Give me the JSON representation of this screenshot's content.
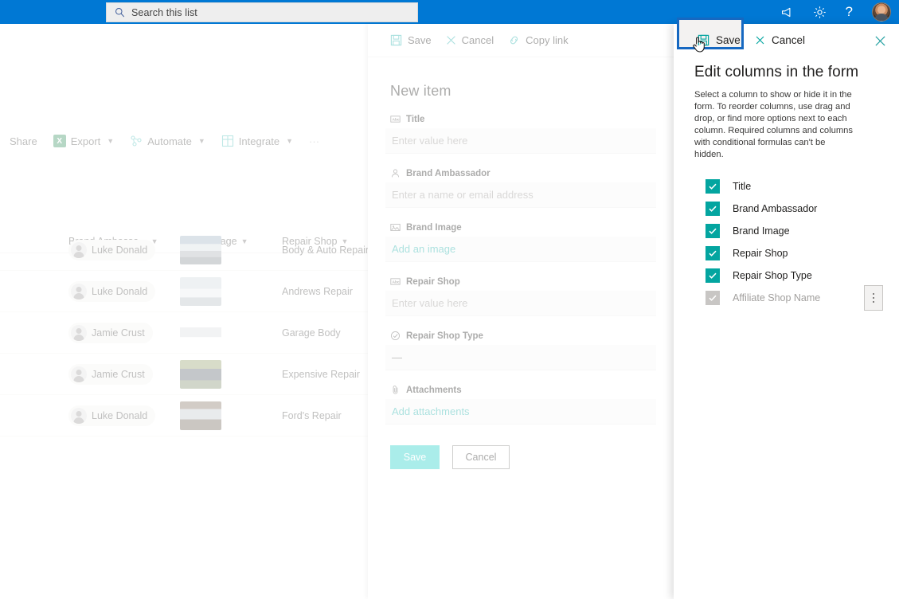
{
  "suite": {
    "search_placeholder": "Search this list",
    "search_value": "",
    "icons": [
      {
        "name": "megaphone-icon",
        "label": "What's new"
      },
      {
        "name": "gear-icon",
        "label": "Settings"
      },
      {
        "name": "help-icon",
        "label": "Help"
      }
    ],
    "avatar_label": "Account manager",
    "brand_color": "#0078d4"
  },
  "list": {
    "commands": [
      {
        "label": "Share",
        "icon": "share-icon",
        "chevron": false
      },
      {
        "label": "Export",
        "icon": "excel-icon",
        "chevron": true
      },
      {
        "label": "Automate",
        "icon": "automate-icon",
        "chevron": true
      },
      {
        "label": "Integrate",
        "icon": "integrate-icon",
        "chevron": true
      },
      {
        "label": "···",
        "icon": "more-icon",
        "chevron": false
      }
    ],
    "columns": [
      {
        "label": "Brand Ambassa...",
        "chevron": true
      },
      {
        "label": "Brand Image",
        "chevron": true
      },
      {
        "label": "Repair Shop",
        "chevron": true
      }
    ],
    "rows": [
      {
        "ambassador": "Luke Donald",
        "image": "car-thumbnail",
        "shop": "Body & Auto Repair"
      },
      {
        "ambassador": "Luke Donald",
        "image": "car-thumbnail",
        "shop": "Andrews Repair"
      },
      {
        "ambassador": "Jamie Crust",
        "image": "car-thumbnail",
        "shop": "Garage Body"
      },
      {
        "ambassador": "Jamie Crust",
        "image": "car-thumbnail",
        "shop": "Expensive Repair"
      },
      {
        "ambassador": "Luke Donald",
        "image": "car-thumbnail",
        "shop": "Ford's Repair"
      }
    ]
  },
  "form": {
    "commands": [
      {
        "label": "Save",
        "icon": "save-icon"
      },
      {
        "label": "Cancel",
        "icon": "close-icon"
      },
      {
        "label": "Copy link",
        "icon": "link-icon"
      }
    ],
    "title": "New item",
    "fields": [
      {
        "label": "Title",
        "icon": "text-field-icon",
        "placeholder": "Enter value here",
        "style": "placeholder"
      },
      {
        "label": "Brand Ambassador",
        "icon": "person-icon",
        "placeholder": "Enter a name or email address",
        "style": "placeholder"
      },
      {
        "label": "Brand Image",
        "icon": "image-icon",
        "placeholder": "Add an image",
        "style": "link"
      },
      {
        "label": "Repair Shop",
        "icon": "text-field-icon",
        "placeholder": "Enter value here",
        "style": "placeholder"
      },
      {
        "label": "Repair Shop Type",
        "icon": "choice-icon",
        "placeholder": "—",
        "style": "value"
      },
      {
        "label": "Attachments",
        "icon": "paperclip-icon",
        "placeholder": "Add attachments",
        "style": "link"
      }
    ],
    "save_label": "Save",
    "cancel_label": "Cancel",
    "accent_color": "#2ed3cb"
  },
  "columns_panel": {
    "save_label": "Save",
    "cancel_label": "Cancel",
    "close_label": "✕",
    "title": "Edit columns in the form",
    "description": "Select a column to show or hide it in the form. To reorder columns, use drag and drop, or find more options next to each column. Required columns and columns with conditional formulas can't be hidden.",
    "checkbox_color": "#03a5a0",
    "highlight_color": "#1668c1",
    "items": [
      {
        "label": "Title",
        "checked": true,
        "disabled": false,
        "has_more": false
      },
      {
        "label": "Brand Ambassador",
        "checked": true,
        "disabled": false,
        "has_more": false
      },
      {
        "label": "Brand Image",
        "checked": true,
        "disabled": false,
        "has_more": false
      },
      {
        "label": "Repair Shop",
        "checked": true,
        "disabled": false,
        "has_more": false
      },
      {
        "label": "Repair Shop Type",
        "checked": true,
        "disabled": false,
        "has_more": false
      },
      {
        "label": "Affiliate Shop Name",
        "checked": true,
        "disabled": true,
        "has_more": true
      }
    ]
  }
}
